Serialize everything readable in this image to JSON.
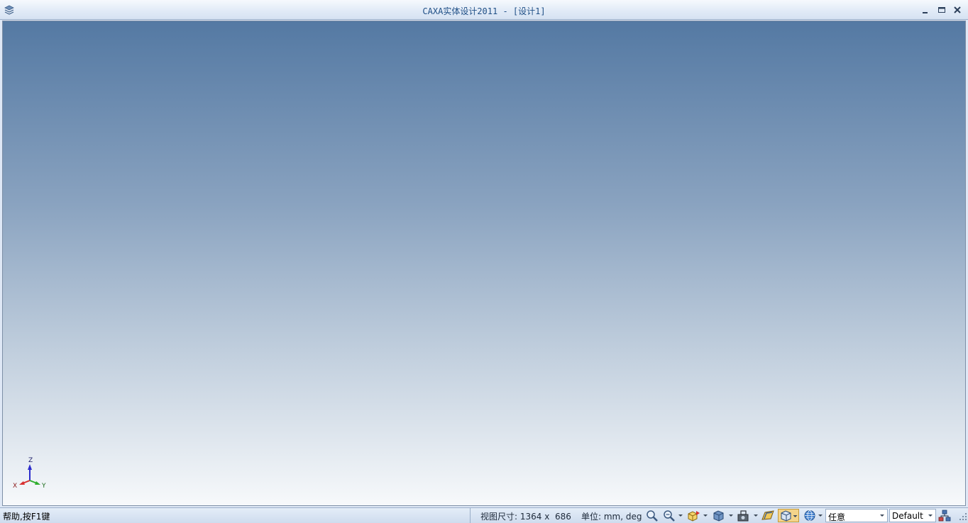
{
  "window": {
    "title": "CAXA实体设计2011 - [设计1]",
    "app_icon": "caxa-logo-icon",
    "controls": [
      "minimize-icon",
      "maximize-icon",
      "close-icon"
    ]
  },
  "viewport": {
    "background_top": "#5479a3",
    "background_bottom": "#f7f9fb",
    "axis": {
      "z_label": "Z",
      "x_label": "X",
      "y_label": "Y"
    },
    "axis_colors": {
      "z": "#2c2ccc",
      "x": "#d83030",
      "y": "#2fae2f"
    }
  },
  "statusbar": {
    "help": "帮助,按F1键",
    "view_size": "视图尺寸: 1364 x  686",
    "units": "单位: mm, deg",
    "tools": [
      "zoom-icon",
      "zoom-dynamic-icon",
      "view-orientation-icon",
      "display-mode-icon",
      "camera-icon",
      "render-icon",
      "shaded-box-icon",
      "globe-icon"
    ],
    "combo_selection": "任意",
    "combo_style": "Default",
    "end_icon": "hierarchy-icon"
  }
}
